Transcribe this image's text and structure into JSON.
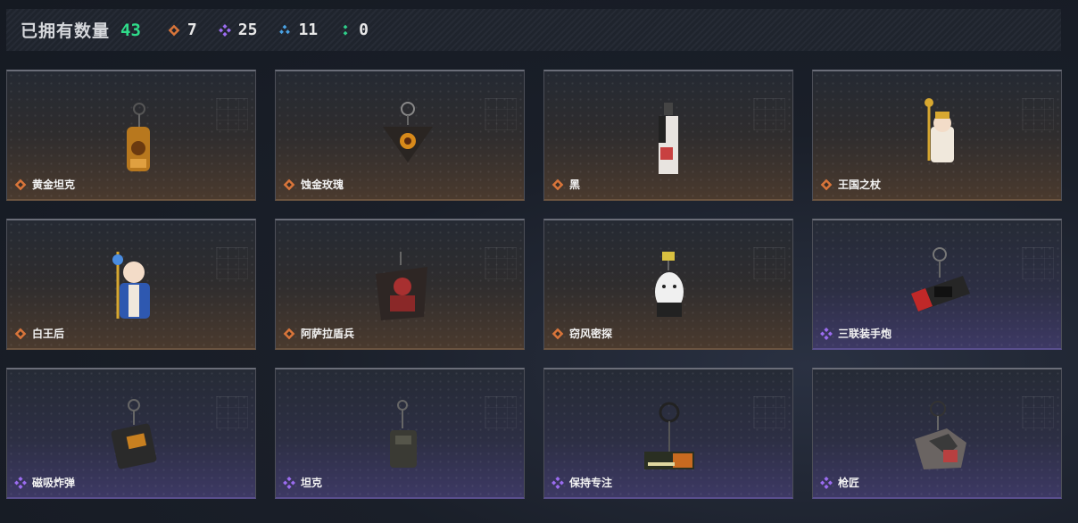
{
  "header": {
    "title": "已拥有数量",
    "total": "43",
    "stats": [
      {
        "icon": "orange-diamond-icon",
        "value": "7",
        "color": "#d9753a"
      },
      {
        "icon": "purple-diamond-icon",
        "value": "25",
        "color": "#9b6cf0"
      },
      {
        "icon": "blue-triangle-icon",
        "value": "11",
        "color": "#4aa3e6"
      },
      {
        "icon": "green-dots-icon",
        "value": "0",
        "color": "#2fcf8a"
      }
    ]
  },
  "colors": {
    "orange": "#d9753a",
    "purple": "#9b6cf0",
    "accent_green": "#2fdc8a"
  },
  "items": [
    {
      "name": "黄金坦克",
      "rarity": "orange"
    },
    {
      "name": "蚀金玫瑰",
      "rarity": "orange"
    },
    {
      "name": "黑",
      "rarity": "orange"
    },
    {
      "name": "王国之杖",
      "rarity": "orange"
    },
    {
      "name": "白王后",
      "rarity": "orange"
    },
    {
      "name": "阿萨拉盾兵",
      "rarity": "orange"
    },
    {
      "name": "窃风密探",
      "rarity": "orange"
    },
    {
      "name": "三联装手炮",
      "rarity": "purple"
    },
    {
      "name": "磁吸炸弹",
      "rarity": "purple"
    },
    {
      "name": "坦克",
      "rarity": "purple"
    },
    {
      "name": "保持专注",
      "rarity": "purple"
    },
    {
      "name": "枪匠",
      "rarity": "purple"
    }
  ]
}
